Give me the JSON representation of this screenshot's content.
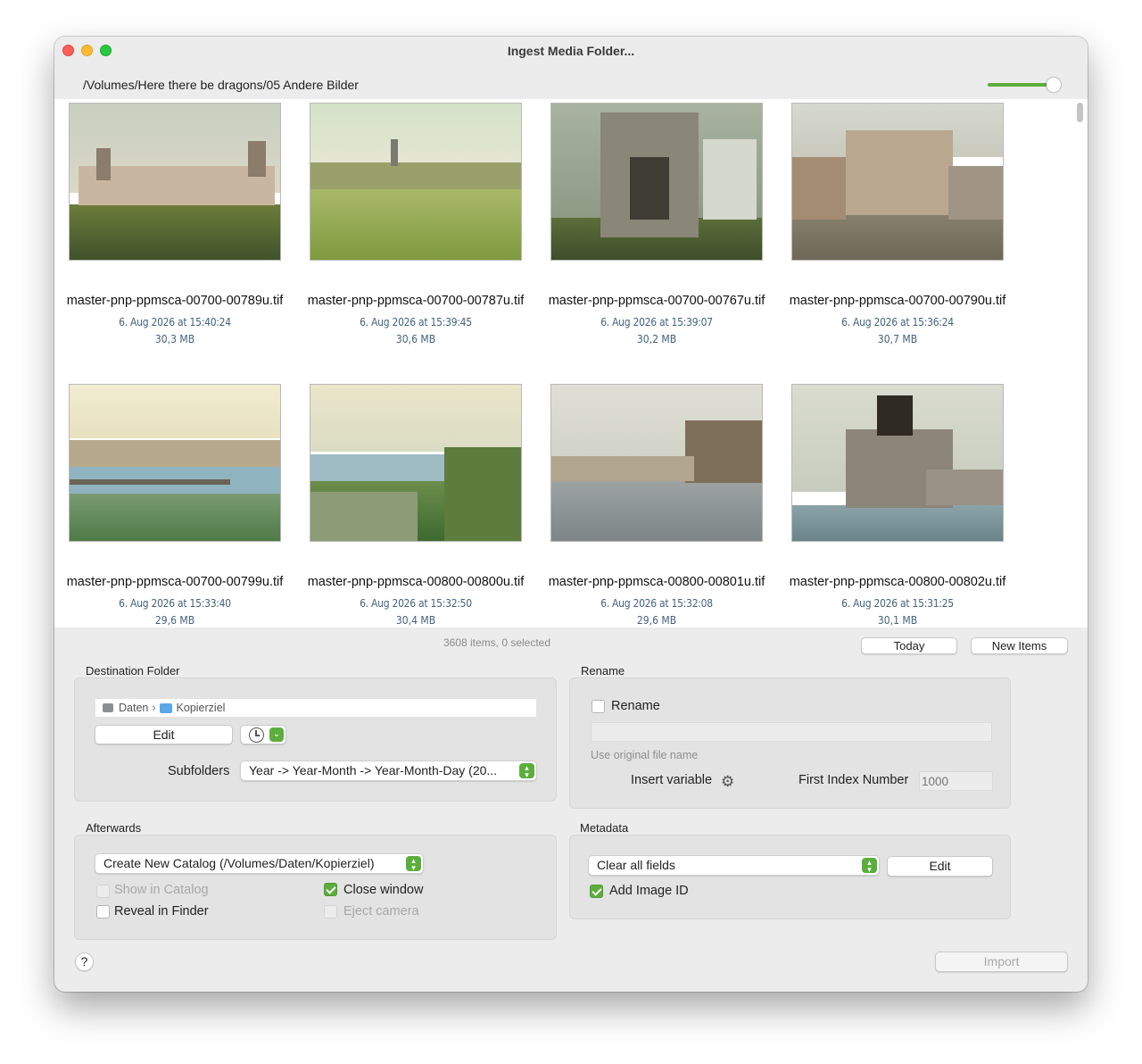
{
  "window": {
    "title": "Ingest Media Folder..."
  },
  "path": "/Volumes/Here there be dragons/05 Andere Bilder",
  "zoom": {
    "level": 0.9
  },
  "files": [
    {
      "name": "master-pnp-ppmsca-00700-00789u.tif",
      "date": "6. Aug 2026 at 15:40:24",
      "size": "30,3 MB",
      "thumb": "palace"
    },
    {
      "name": "master-pnp-ppmsca-00700-00787u.tif",
      "date": "6. Aug 2026 at 15:39:45",
      "size": "30,6 MB",
      "thumb": "town-panorama"
    },
    {
      "name": "master-pnp-ppmsca-00700-00767u.tif",
      "date": "6. Aug 2026 at 15:39:07",
      "size": "30,2 MB",
      "thumb": "ruin"
    },
    {
      "name": "master-pnp-ppmsca-00700-00790u.tif",
      "date": "6. Aug 2026 at 15:36:24",
      "size": "30,7 MB",
      "thumb": "market-square"
    },
    {
      "name": "master-pnp-ppmsca-00700-00799u.tif",
      "date": "6. Aug 2026 at 15:33:40",
      "size": "29,6 MB",
      "thumb": "river-bridge"
    },
    {
      "name": "master-pnp-ppmsca-00800-00800u.tif",
      "date": "6. Aug 2026 at 15:32:50",
      "size": "30,4 MB",
      "thumb": "river-valley"
    },
    {
      "name": "master-pnp-ppmsca-00800-00801u.tif",
      "date": "6. Aug 2026 at 15:32:08",
      "size": "29,6 MB",
      "thumb": "riverside-castle"
    },
    {
      "name": "master-pnp-ppmsca-00800-00802u.tif",
      "date": "6. Aug 2026 at 15:31:25",
      "size": "30,1 MB",
      "thumb": "equestrian-monument"
    }
  ],
  "status": "3608 items, 0 selected",
  "today_button": "Today",
  "new_items_button": "New Items",
  "destination": {
    "label": "Destination Folder",
    "path_volume": "Daten",
    "path_folder": "Kopierziel",
    "edit_button": "Edit",
    "subfolders_label": "Subfolders",
    "subfolders_value": "Year -> Year-Month -> Year-Month-Day   (20..."
  },
  "rename": {
    "label": "Rename",
    "checkbox_label": "Rename",
    "checked": false,
    "hint": "Use original file name",
    "insert_variable": "Insert variable",
    "first_index_label": "First Index Number",
    "first_index_placeholder": "1000"
  },
  "afterwards": {
    "label": "Afterwards",
    "catalog_option": "Create New Catalog (/Volumes/Daten/Kopierziel)",
    "show_in_catalog": "Show in Catalog",
    "close_window": "Close window",
    "reveal_in_finder": "Reveal in Finder",
    "eject_camera": "Eject camera"
  },
  "metadata": {
    "label": "Metadata",
    "option": "Clear all fields",
    "edit_button": "Edit",
    "add_image_id": "Add Image ID"
  },
  "help_button": "?",
  "import_button": "Import",
  "colors": {
    "accent": "#5cae3c",
    "meta_text": "#43627e"
  }
}
